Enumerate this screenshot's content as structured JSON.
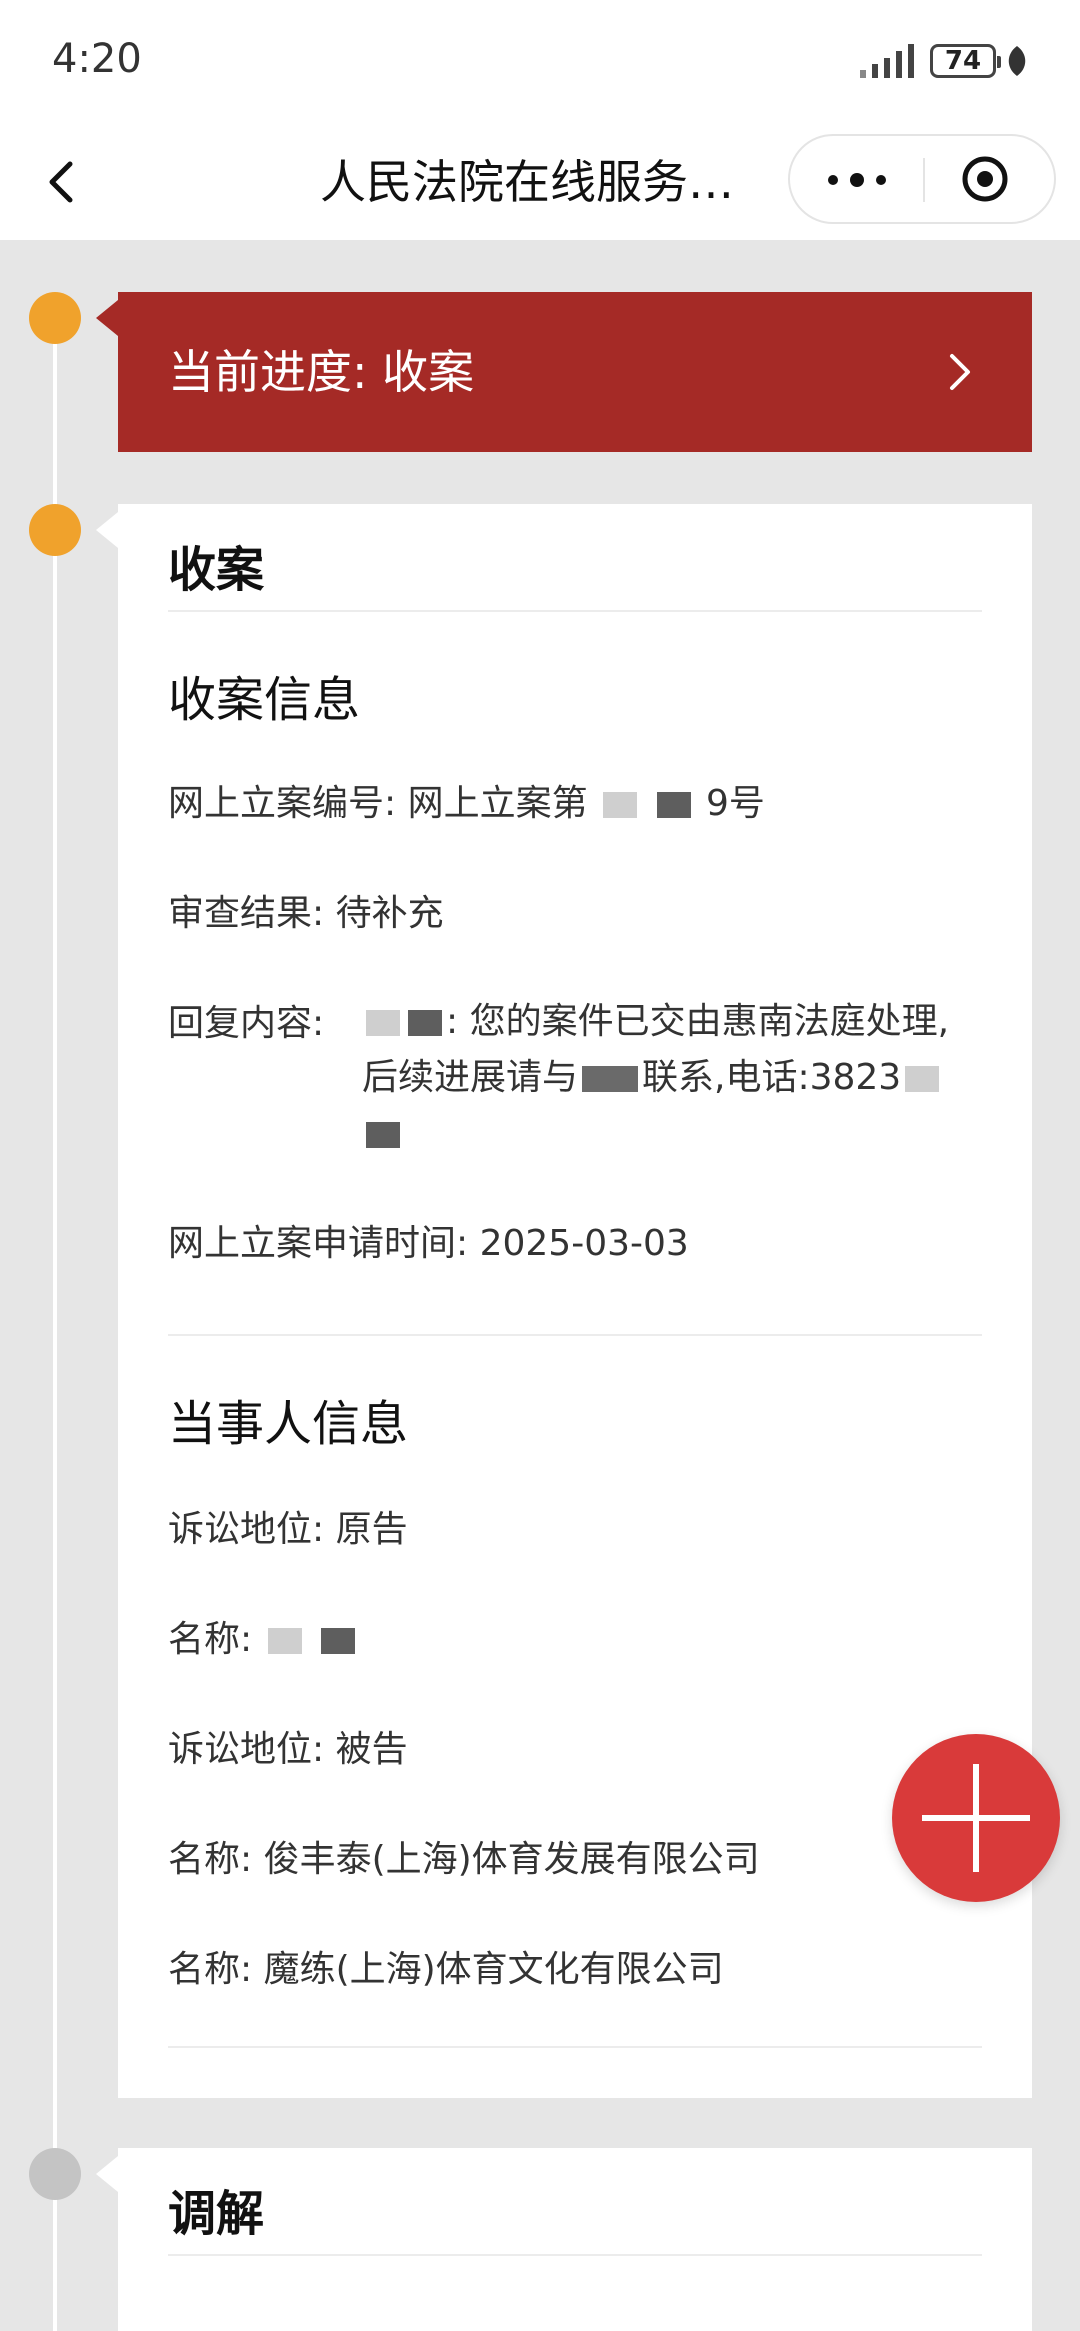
{
  "status_bar": {
    "time": "4:20",
    "battery": "74"
  },
  "nav": {
    "title": "人民法院在线服务…"
  },
  "progress": {
    "label": "当前进度:",
    "value": "收案"
  },
  "stage_current": {
    "title": "收案",
    "filing_info": {
      "heading": "收案信息",
      "case_number_label": "网上立案编号:",
      "case_number_prefix": "网上立案第",
      "case_number_suffix": "9号",
      "review_result_label": "审查结果:",
      "review_result_value": "待补充",
      "reply_label": "回复内容:",
      "reply_part1": ": 您的案件已交由惠南法庭处理,后续进展请与",
      "reply_part2": "联系,电话:3823",
      "apply_time_label": "网上立案申请时间:",
      "apply_time_value": "2025-03-03"
    },
    "party_info": {
      "heading": "当事人信息",
      "parties": [
        {
          "role_label": "诉讼地位:",
          "role_value": "原告"
        },
        {
          "name_label": "名称:",
          "name_value": ""
        },
        {
          "role_label": "诉讼地位:",
          "role_value": "被告"
        },
        {
          "name_label": "名称:",
          "name_value": "俊丰泰(上海)体育发展有限公司"
        },
        {
          "name_label": "名称:",
          "name_value": "魔练(上海)体育文化有限公司"
        }
      ]
    }
  },
  "stage_next": {
    "title": "调解"
  },
  "colors": {
    "accent_red": "#a52a26",
    "timeline_orange": "#f0a22c",
    "fab_red": "#d93a3a"
  }
}
